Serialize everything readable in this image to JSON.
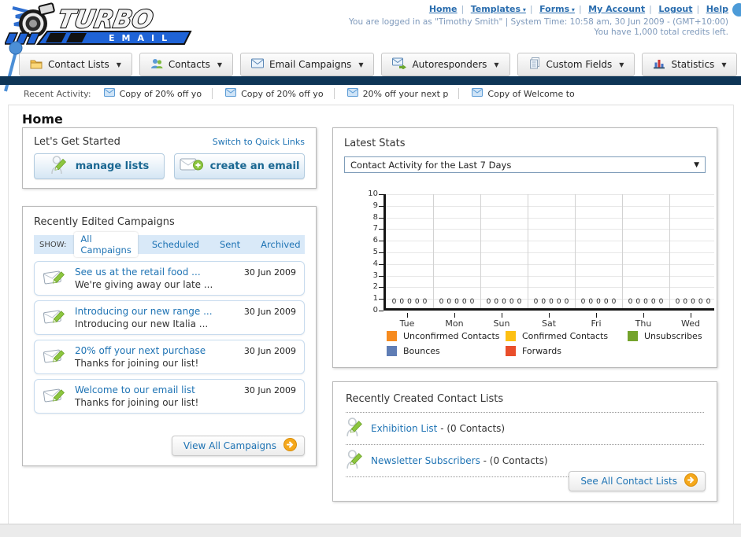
{
  "header": {
    "logo": {
      "title": "TURBO",
      "subtitle": "EMAIL"
    },
    "nav": {
      "separator": "|",
      "links": [
        {
          "label": "Home",
          "dropdown": false
        },
        {
          "label": "Templates",
          "dropdown": true
        },
        {
          "label": "Forms",
          "dropdown": true
        },
        {
          "label": "My Account",
          "dropdown": false
        },
        {
          "label": "Logout",
          "dropdown": false
        },
        {
          "label": "Help",
          "dropdown": false
        }
      ]
    },
    "session_line": "You are logged in as \"Timothy Smith\" | System Time: 10:58 am, 30 Jun 2009 - (GMT+10:00)",
    "credits_line": "You have 1,000 total credits left."
  },
  "main_tabs": [
    {
      "label": "Contact Lists",
      "icon": "contact-lists-icon"
    },
    {
      "label": "Contacts",
      "icon": "contacts-icon"
    },
    {
      "label": "Email Campaigns",
      "icon": "email-campaigns-icon"
    },
    {
      "label": "Autoresponders",
      "icon": "autoresponders-icon"
    },
    {
      "label": "Custom Fields",
      "icon": "custom-fields-icon"
    },
    {
      "label": "Statistics",
      "icon": "statistics-icon"
    }
  ],
  "recent_activity": {
    "label": "Recent Activity:",
    "items": [
      "Copy of 20% off yo",
      "Copy of 20% off yo",
      "20% off your next p",
      "Copy of Welcome to"
    ]
  },
  "page_title": "Home",
  "get_started": {
    "title": "Let's Get Started",
    "switch_link": "Switch to Quick Links",
    "buttons": [
      {
        "label": "manage lists",
        "icon": "manage-lists-icon"
      },
      {
        "label": "create an email",
        "icon": "create-email-icon"
      }
    ]
  },
  "campaigns": {
    "title": "Recently Edited Campaigns",
    "show_label": "SHOW:",
    "filters": [
      {
        "label": "All Campaigns",
        "selected": true
      },
      {
        "label": "Scheduled",
        "selected": false
      },
      {
        "label": "Sent",
        "selected": false
      },
      {
        "label": "Archived",
        "selected": false
      }
    ],
    "items": [
      {
        "title": "See us at the retail food ...",
        "subtitle": "We're giving away our late ...",
        "date": "30 Jun 2009"
      },
      {
        "title": "Introducing our new range ...",
        "subtitle": "Introducing our new Italia ...",
        "date": "30 Jun 2009"
      },
      {
        "title": "20% off your next purchase",
        "subtitle": "Thanks for joining our list!",
        "date": "30 Jun 2009"
      },
      {
        "title": "Welcome to our email list",
        "subtitle": "Thanks for joining our list!",
        "date": "30 Jun 2009"
      }
    ],
    "view_all_label": "View All Campaigns"
  },
  "stats": {
    "title": "Latest Stats",
    "period_selected": "Contact Activity for the Last 7 Days"
  },
  "chart_data": {
    "type": "bar",
    "title": "Contact Activity for the Last 7 Days",
    "categories": [
      "Tue",
      "Mon",
      "Sun",
      "Sat",
      "Fri",
      "Thu",
      "Wed"
    ],
    "series": [
      {
        "name": "Unconfirmed Contacts",
        "color": "#F68B1F",
        "values": [
          0,
          0,
          0,
          0,
          0,
          0,
          0
        ]
      },
      {
        "name": "Confirmed Contacts",
        "color": "#FDC013",
        "values": [
          0,
          0,
          0,
          0,
          0,
          0,
          0
        ]
      },
      {
        "name": "Unsubscribes",
        "color": "#74A32C",
        "values": [
          0,
          0,
          0,
          0,
          0,
          0,
          0
        ]
      },
      {
        "name": "Bounces",
        "color": "#5F7DB5",
        "values": [
          0,
          0,
          0,
          0,
          0,
          0,
          0
        ]
      },
      {
        "name": "Forwards",
        "color": "#E94E2B",
        "values": [
          0,
          0,
          0,
          0,
          0,
          0,
          0
        ]
      }
    ],
    "ylim": [
      0,
      10
    ],
    "yticks": [
      0,
      1,
      2,
      3,
      4,
      5,
      6,
      7,
      8,
      9,
      10
    ],
    "grid": true,
    "legend_position": "bottom"
  },
  "contact_lists": {
    "title": "Recently Created Contact Lists",
    "items": [
      {
        "name": "Exhibition List",
        "detail": "- (0 Contacts)"
      },
      {
        "name": "Newsletter Subscribers",
        "detail": "- (0 Contacts)"
      }
    ],
    "see_all_label": "See All Contact Lists"
  },
  "colors": {
    "navy_bar": "#0E3556",
    "link_blue": "#1E73B4",
    "accent_orange": "#F5A81C"
  }
}
